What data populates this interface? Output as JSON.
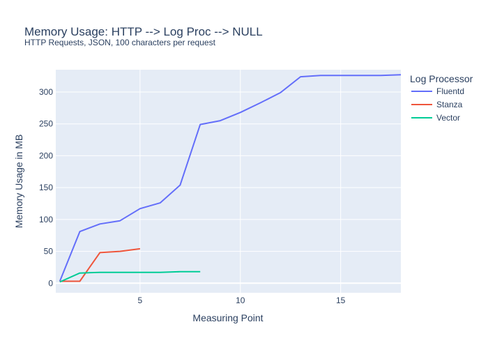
{
  "chart_data": {
    "type": "line",
    "title": "Memory Usage: HTTP --> Log Proc --> NULL",
    "subtitle": "HTTP Requests, JSON, 100 characters per request",
    "xlabel": "Measuring Point",
    "ylabel": "Memory Usage in MB",
    "xlim": [
      0.8,
      18
    ],
    "ylim": [
      -15,
      335
    ],
    "xticks": [
      5,
      10,
      15
    ],
    "yticks": [
      0,
      50,
      100,
      150,
      200,
      250,
      300
    ],
    "grid": true,
    "legend_title": "Log Processor",
    "legend_position": "top-right",
    "plot_background": "#E5ECF6",
    "series": [
      {
        "name": "Fluentd",
        "color": "#636EFA",
        "x": [
          1,
          2,
          3,
          4,
          5,
          6,
          7,
          8,
          9,
          10,
          11,
          12,
          13,
          14,
          15,
          16,
          17,
          18
        ],
        "y": [
          3,
          81,
          93,
          98,
          117,
          126,
          154,
          249,
          255,
          268,
          283,
          299,
          324,
          326,
          326,
          326,
          326,
          327
        ]
      },
      {
        "name": "Stanza",
        "color": "#EF553B",
        "x": [
          1,
          2,
          3,
          4,
          5
        ],
        "y": [
          3,
          3,
          48,
          50,
          54
        ]
      },
      {
        "name": "Vector",
        "color": "#00CC96",
        "x": [
          1,
          2,
          3,
          4,
          5,
          6,
          7,
          8
        ],
        "y": [
          2,
          16,
          17,
          17,
          17,
          17,
          18,
          18
        ]
      }
    ]
  }
}
